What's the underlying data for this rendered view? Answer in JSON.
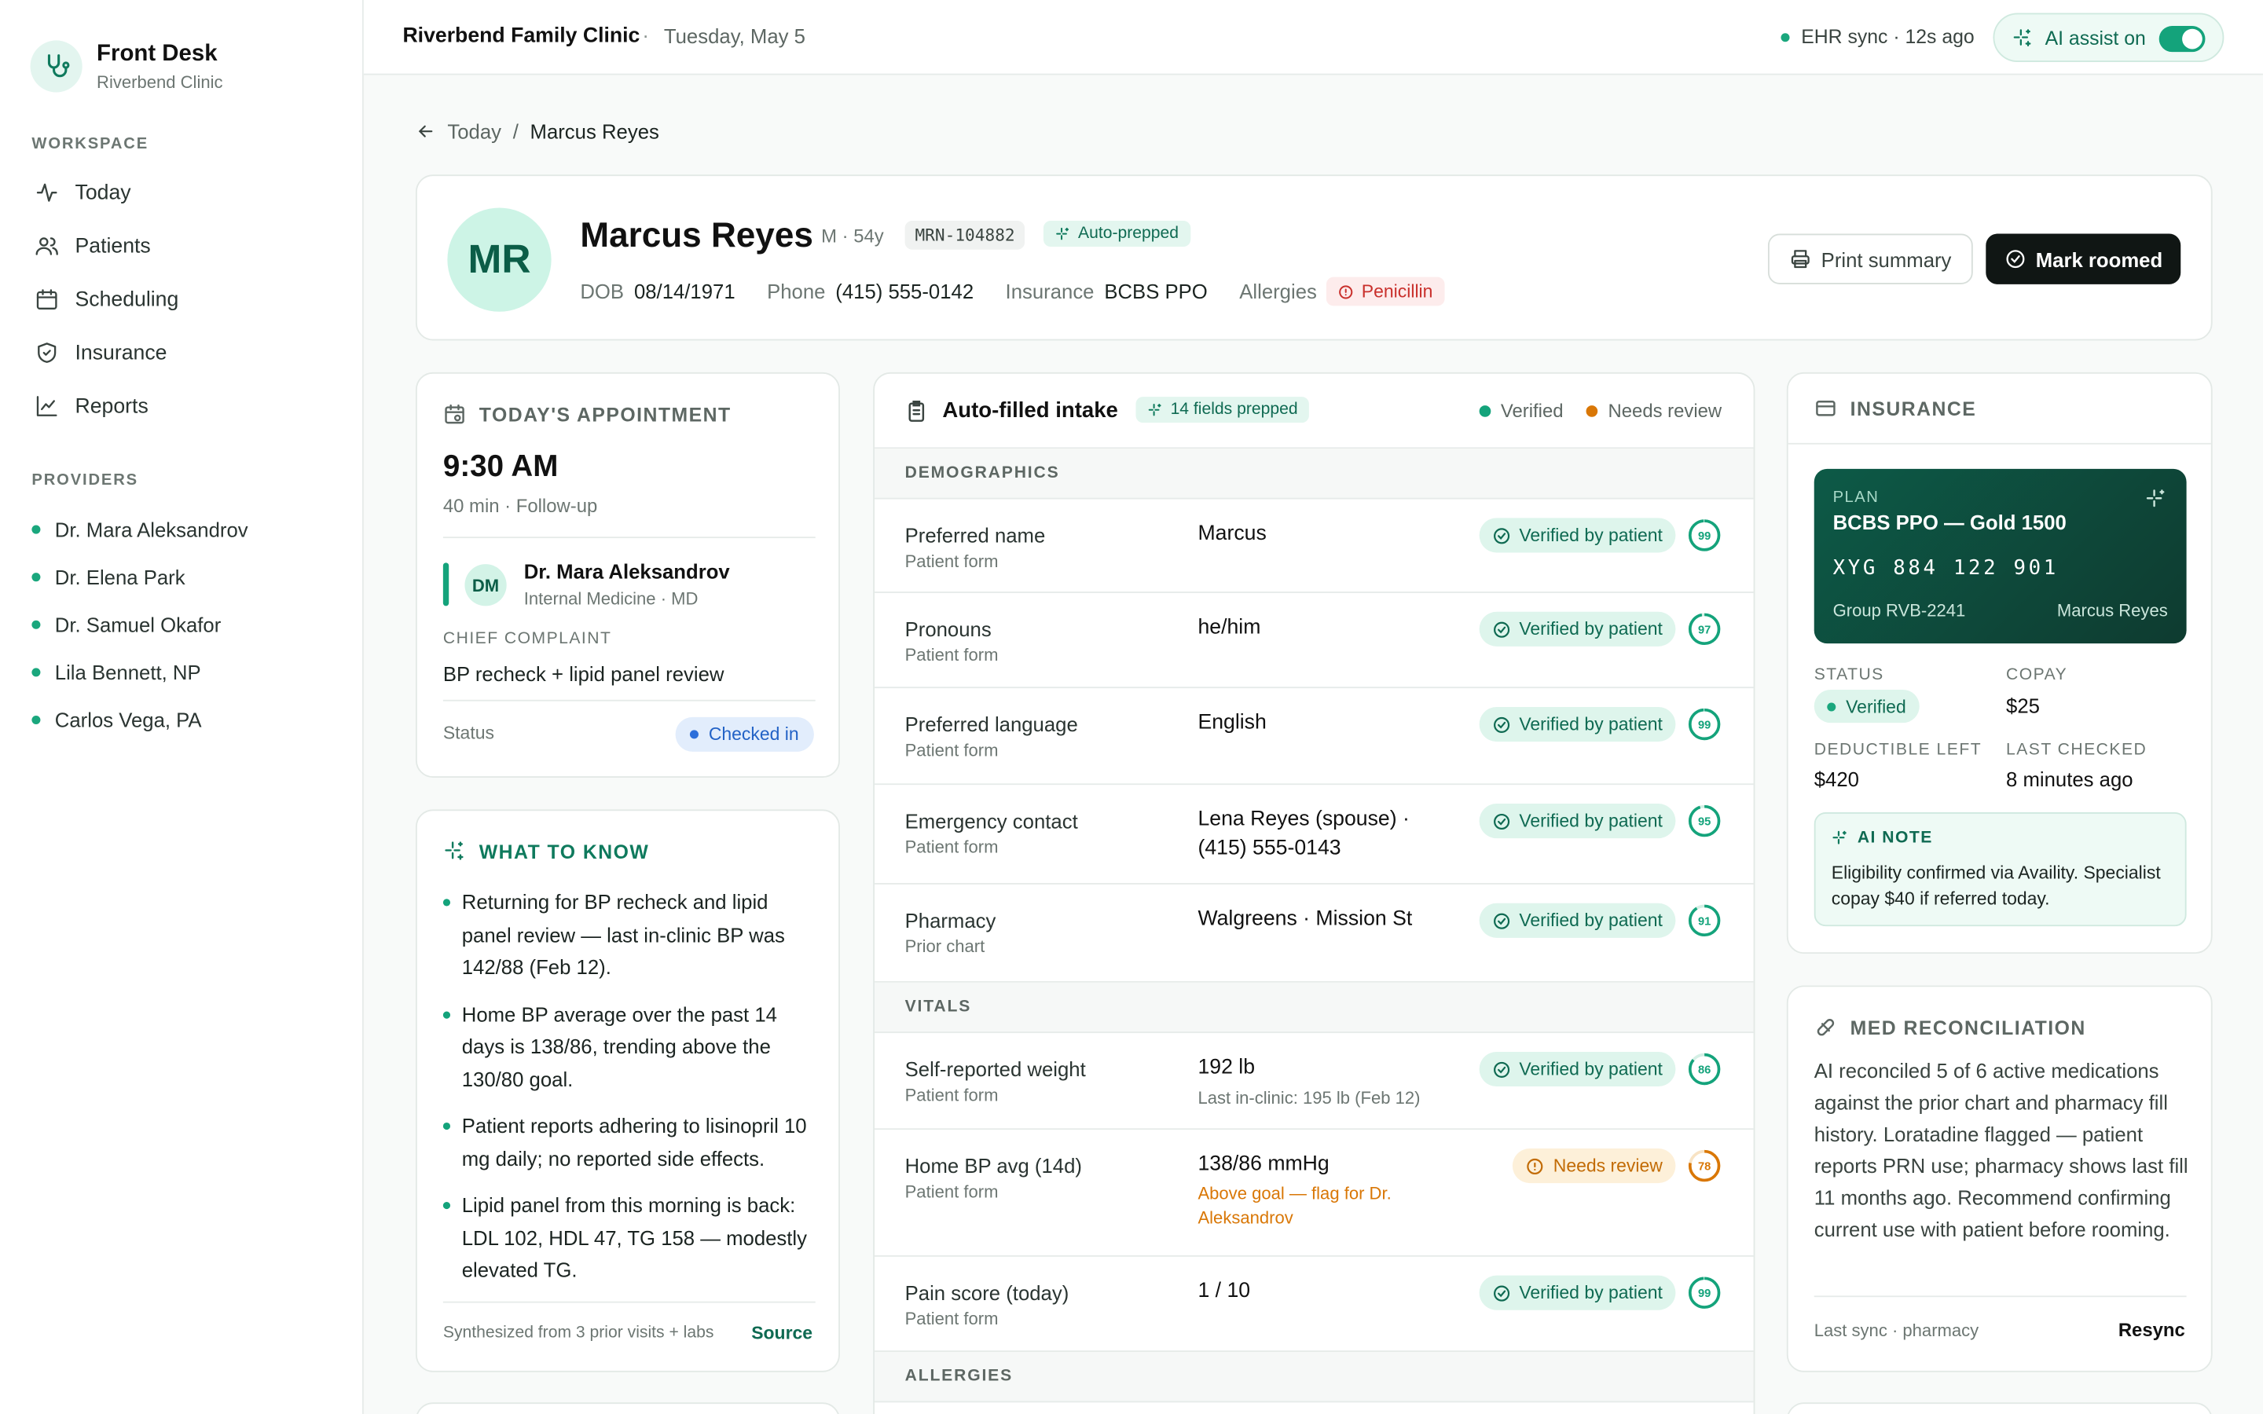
{
  "sidebar": {
    "brand_title": "Front Desk",
    "brand_sub": "Riverbend Clinic",
    "workspace_label": "WORKSPACE",
    "nav": [
      "Today",
      "Patients",
      "Scheduling",
      "Insurance",
      "Reports"
    ],
    "providers_label": "PROVIDERS",
    "providers": [
      "Dr. Mara Aleksandrov",
      "Dr. Elena Park",
      "Dr. Samuel Okafor",
      "Lila Bennett, NP",
      "Carlos Vega, PA"
    ]
  },
  "topbar": {
    "clinic": "Riverbend Family Clinic",
    "sep": "·",
    "date": "Tuesday, May 5",
    "sync": "EHR sync · 12s ago",
    "ai_assist": "AI assist on"
  },
  "breadcrumb": {
    "back": "Today",
    "sep": "/",
    "current": "Marcus Reyes"
  },
  "patient": {
    "initials": "MR",
    "name": "Marcus Reyes",
    "meta": "M · 54y",
    "mrn": "MRN-104882",
    "auto_badge": "Auto-prepped",
    "dob_label": "DOB",
    "dob": "08/14/1971",
    "phone_label": "Phone",
    "phone": "(415) 555-0142",
    "insurance_label": "Insurance",
    "insurance": "BCBS PPO",
    "allergies_label": "Allergies",
    "allergy": "Penicillin",
    "print_label": "Print summary",
    "roomed_label": "Mark roomed"
  },
  "appointment": {
    "title": "TODAY'S APPOINTMENT",
    "time": "9:30 AM",
    "duration": "40 min · Follow-up",
    "doctor_initials": "DM",
    "doctor": "Dr. Mara Aleksandrov",
    "specialty": "Internal Medicine · MD",
    "cc_label": "CHIEF COMPLAINT",
    "cc": "BP recheck + lipid panel review",
    "status_label": "Status",
    "status": "Checked in"
  },
  "what_to_know": {
    "title": "WHAT TO KNOW",
    "items": [
      "Returning for BP recheck and lipid panel review — last in-clinic BP was 142/88 (Feb 12).",
      "Home BP average over the past 14 days is 138/86, trending above the 130/80 goal.",
      "Patient reports adhering to lisinopril 10 mg daily; no reported side effects.",
      "Lipid panel from this morning is back: LDL 102, HDL 47, TG 158 — modestly elevated TG."
    ],
    "footer": "Synthesized from 3 prior visits + labs",
    "source": "Source"
  },
  "intake": {
    "title": "Auto-filled intake",
    "badge": "14 fields prepped",
    "legend_verified": "Verified",
    "legend_review": "Needs review",
    "sections": {
      "demographics": "DEMOGRAPHICS",
      "vitals": "VITALS",
      "allergies": "ALLERGIES"
    },
    "rows": [
      {
        "label": "Preferred name",
        "source": "Patient form",
        "value": "Marcus",
        "sub": "",
        "status": "Verified by patient",
        "score": 99,
        "level": "verified"
      },
      {
        "label": "Pronouns",
        "source": "Patient form",
        "value": "he/him",
        "sub": "",
        "status": "Verified by patient",
        "score": 97,
        "level": "verified"
      },
      {
        "label": "Preferred language",
        "source": "Patient form",
        "value": "English",
        "sub": "",
        "status": "Verified by patient",
        "score": 99,
        "level": "verified"
      },
      {
        "label": "Emergency contact",
        "source": "Patient form",
        "value": "Lena Reyes (spouse) · (415) 555-0143",
        "sub": "",
        "status": "Verified by patient",
        "score": 95,
        "level": "verified"
      },
      {
        "label": "Pharmacy",
        "source": "Prior chart",
        "value": "Walgreens · Mission St",
        "sub": "",
        "status": "Verified by patient",
        "score": 91,
        "level": "verified"
      },
      {
        "label": "Self-reported weight",
        "source": "Patient form",
        "value": "192 lb",
        "sub": "Last in-clinic: 195 lb (Feb 12)",
        "status": "Verified by patient",
        "score": 86,
        "level": "verified"
      },
      {
        "label": "Home BP avg (14d)",
        "source": "Patient form",
        "value": "138/86 mmHg",
        "sub": "Above goal — flag for Dr. Aleksandrov",
        "status": "Needs review",
        "score": 78,
        "level": "review"
      },
      {
        "label": "Pain score (today)",
        "source": "Patient form",
        "value": "1 / 10",
        "sub": "",
        "status": "Verified by patient",
        "score": 99,
        "level": "verified"
      }
    ]
  },
  "insurance": {
    "title": "INSURANCE",
    "plan_label": "PLAN",
    "plan": "BCBS PPO — Gold 1500",
    "member_id": "XYG 884 122 901",
    "group": "Group RVB-2241",
    "holder": "Marcus Reyes",
    "status_label": "STATUS",
    "status": "Verified",
    "copay_label": "COPAY",
    "copay": "$25",
    "deductible_label": "DEDUCTIBLE LEFT",
    "deductible": "$420",
    "checked_label": "LAST CHECKED",
    "checked": "8 minutes ago",
    "note_title": "AI NOTE",
    "note": "Eligibility confirmed via Availity. Specialist copay $40 if referred today."
  },
  "med_rec": {
    "title": "MED RECONCILIATION",
    "body": "AI reconciled 5 of 6 active medications against the prior chart and pharmacy fill history. Loratadine flagged — patient reports PRN use; pharmacy shows last fill 11 months ago. Recommend confirming current use with patient before rooming.",
    "footer": "Last sync · pharmacy",
    "resync": "Resync"
  },
  "colors": {
    "accent": "#14a37b",
    "warn": "#d97706",
    "dark": "#101614"
  }
}
